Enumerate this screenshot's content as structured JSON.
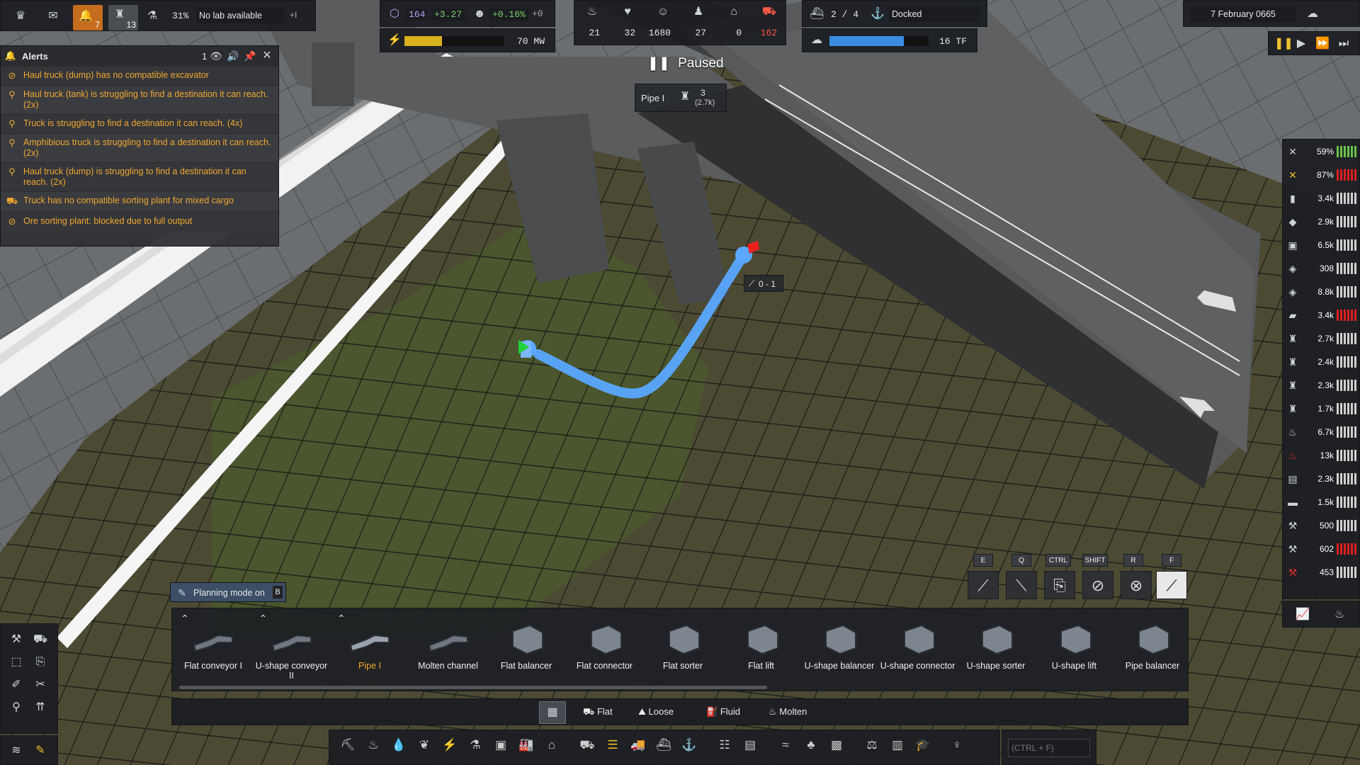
{
  "top_left": {
    "alerts_count": "7",
    "research_count": "13",
    "research_pct": "31%",
    "lab_status": "No lab available",
    "plus_label": "+I"
  },
  "top_center": {
    "unity": "164",
    "unity_delta": "+3.27",
    "pop_growth": "+0.16%",
    "pop_delta": "+0",
    "power_value": "70 MW",
    "power_fill": 0.38,
    "stats": [
      "21",
      "32",
      "1680",
      "27",
      "0",
      "162"
    ]
  },
  "top_right": {
    "ships": "2 / 4",
    "ship_status": "Docked",
    "compute_value": "16 TF",
    "compute_fill": 0.75,
    "date": "7 February 0665"
  },
  "paused_label": "Paused",
  "tooltip": {
    "name": "Pipe I",
    "count": "3",
    "sub": "(2.7k)"
  },
  "measure_label": "0 - 1",
  "alerts": {
    "title": "Alerts",
    "count": "1",
    "items": [
      {
        "icon": "blocked-icon",
        "text": "Haul truck (dump) has no compatible excavator"
      },
      {
        "icon": "pin-icon",
        "text": "Haul truck (tank) is struggling to find a destination it can reach. (2x)"
      },
      {
        "icon": "pin-icon",
        "text": "Truck is struggling to find a destination it can reach. (4x)"
      },
      {
        "icon": "pin-icon",
        "text": "Amphibious truck is struggling to find a destination it can reach. (2x)"
      },
      {
        "icon": "pin-icon",
        "text": "Haul truck (dump) is struggling to find a destination it can reach. (2x)"
      },
      {
        "icon": "truck-icon",
        "text": "Truck has no compatible sorting plant for mixed cargo"
      },
      {
        "icon": "blocked-icon",
        "text": "Ore sorting plant: blocked due to full output"
      }
    ]
  },
  "resources": [
    {
      "value": "59%",
      "icon": "tools-icon",
      "bars": "grn"
    },
    {
      "value": "87%",
      "icon": "tools-yellow-icon",
      "bars": "red"
    },
    {
      "value": "3.4k",
      "icon": "wood-icon",
      "bars": ""
    },
    {
      "value": "2.9k",
      "icon": "rock-icon",
      "bars": ""
    },
    {
      "value": "6.5k",
      "icon": "cube-icon",
      "bars": ""
    },
    {
      "value": "308",
      "icon": "plate-icon",
      "bars": ""
    },
    {
      "value": "8.8k",
      "icon": "plate-icon",
      "bars": ""
    },
    {
      "value": "3.4k",
      "icon": "plank-icon",
      "bars": "red"
    },
    {
      "value": "2.7k",
      "icon": "worker-icon",
      "bars": ""
    },
    {
      "value": "2.4k",
      "icon": "worker-icon",
      "bars": ""
    },
    {
      "value": "2.3k",
      "icon": "worker-icon",
      "bars": ""
    },
    {
      "value": "1.7k",
      "icon": "worker-icon",
      "bars": ""
    },
    {
      "value": "6.7k",
      "icon": "fuel-icon",
      "bars": ""
    },
    {
      "value": "13k",
      "icon": "fuel-red-icon",
      "bars": ""
    },
    {
      "value": "2.3k",
      "icon": "canister-icon",
      "bars": ""
    },
    {
      "value": "1.5k",
      "icon": "barrel-icon",
      "bars": ""
    },
    {
      "value": "500",
      "icon": "wrench-icon",
      "bars": ""
    },
    {
      "value": "602",
      "icon": "wrench-icon",
      "bars": "red"
    },
    {
      "value": "453",
      "icon": "wrench-red-icon",
      "bars": ""
    }
  ],
  "planning": {
    "label": "Planning mode on",
    "key": "B"
  },
  "keys": [
    "E",
    "Q",
    "CTRL",
    "SHIFT",
    "R",
    "F"
  ],
  "toolbar_items": [
    {
      "label": "Flat conveyor I"
    },
    {
      "label": "U-shape conveyor II"
    },
    {
      "label": "Pipe I"
    },
    {
      "label": "Molten channel"
    },
    {
      "label": "Flat balancer"
    },
    {
      "label": "Flat connector"
    },
    {
      "label": "Flat sorter"
    },
    {
      "label": "Flat lift"
    },
    {
      "label": "U-shape balancer"
    },
    {
      "label": "U-shape connector"
    },
    {
      "label": "U-shape sorter"
    },
    {
      "label": "U-shape lift"
    },
    {
      "label": "Pipe balancer"
    }
  ],
  "categories": [
    "Flat",
    "Loose",
    "Fluid",
    "Molten"
  ],
  "search_placeholder": "(CTRL + F)",
  "colors": {
    "accent": "#f0a830",
    "pipe": "#5aa8ff"
  }
}
